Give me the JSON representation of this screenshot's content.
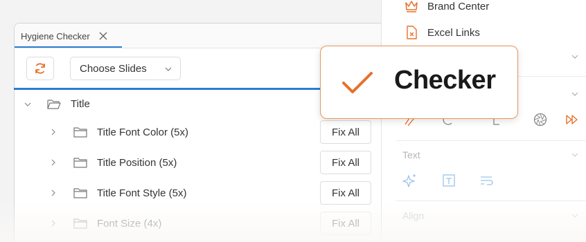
{
  "pane": {
    "tab_title": "Hygiene Checker",
    "help_label": "?",
    "toolbar": {
      "choose_slides_label": "Choose Slides"
    },
    "tree": {
      "root_label": "Title",
      "items": [
        {
          "label": "Title Font Color (5x)",
          "action": "Fix All"
        },
        {
          "label": "Title Position (5x)",
          "action": "Fix All"
        },
        {
          "label": "Title Font Style (5x)",
          "action": "Fix All"
        },
        {
          "label": "Font Size (4x)",
          "action": "Fix All"
        }
      ]
    }
  },
  "ribbon": {
    "items": [
      {
        "label": "Brand Center",
        "icon": "crown-icon"
      },
      {
        "label": "Excel Links",
        "icon": "excel-file-icon"
      }
    ],
    "sections": [
      {
        "label": "Text"
      },
      {
        "label": "Align"
      }
    ]
  },
  "callout": {
    "label": "Checker"
  },
  "colors": {
    "accent_orange": "#e8702a",
    "accent_blue": "#2b7cd3"
  }
}
